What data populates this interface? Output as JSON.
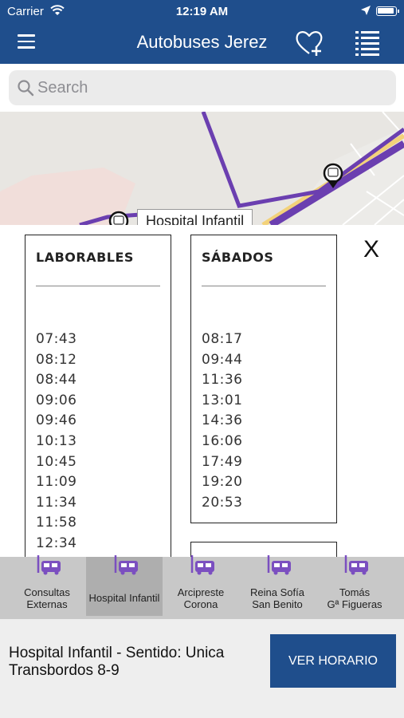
{
  "status_bar": {
    "carrier": "Carrier",
    "time": "12:19 AM"
  },
  "nav": {
    "title": "Autobuses Jerez",
    "menu_icon": "hamburger-icon",
    "favorite_icon": "heart-plus-icon",
    "list_icon": "list-icon"
  },
  "search": {
    "placeholder": "Search",
    "value": ""
  },
  "map": {
    "popup_label": "Hospital Infantil"
  },
  "schedule": {
    "close_label": "X",
    "weekday": {
      "heading": "LABORABLES",
      "times": [
        "07:43",
        "08:12",
        "08:44",
        "09:06",
        "09:46",
        "10:13",
        "10:45",
        "11:09",
        "11:34",
        "11:58",
        "12:34"
      ]
    },
    "saturday": {
      "heading": "SÁBADOS",
      "times": [
        "08:17",
        "09:44",
        "11:36",
        "13:01",
        "14:36",
        "16:06",
        "17:49",
        "19:20",
        "20:53"
      ]
    }
  },
  "stops": [
    {
      "label": "Consultas Externas",
      "active": false
    },
    {
      "label": "Hospital Infantil",
      "active": true
    },
    {
      "label": "Arcipreste Corona",
      "active": false
    },
    {
      "label": "Reina Sofía San Benito",
      "active": false
    },
    {
      "label": "Tomás Gª Figueras",
      "active": false
    }
  ],
  "footer": {
    "route_line1": "Hospital Infantil - Sentido: Unica",
    "route_line2": "Transbordos 8-9",
    "button_label": "VER HORARIO"
  },
  "colors": {
    "brand_blue": "#1f4e8c",
    "route_purple": "#6b3fb0",
    "bus_icon_purple": "#7b4fc0"
  }
}
